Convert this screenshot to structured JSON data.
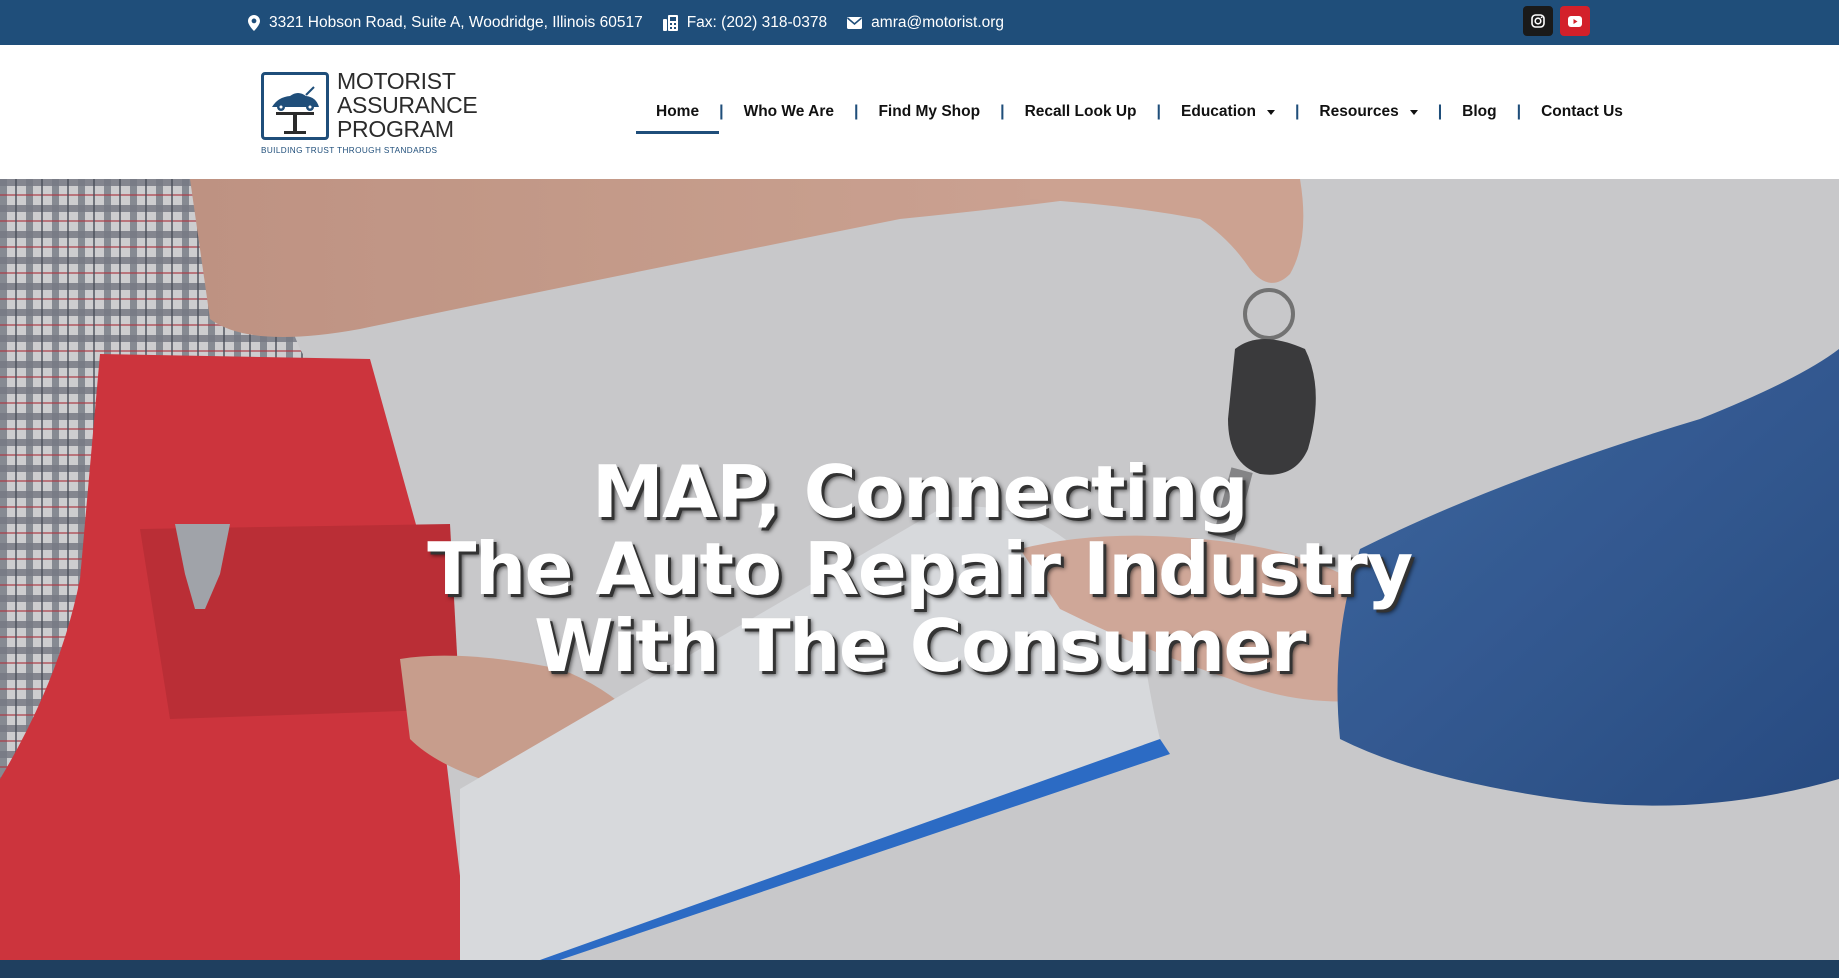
{
  "topbar": {
    "address": "3321 Hobson Road, Suite A, Woodridge, Illinois 60517",
    "fax": "Fax: (202) 318-0378",
    "email": "amra@motorist.org",
    "icons": [
      "map-pin-icon",
      "fax-icon",
      "envelope-icon"
    ],
    "socials": [
      "instagram-icon",
      "youtube-icon"
    ],
    "background_color": "#1f4e7a"
  },
  "logo": {
    "line1": "MOTORIST",
    "line2": "ASSURANCE",
    "line3": "PROGRAM",
    "tagline": "BUILDING TRUST THROUGH STANDARDS"
  },
  "nav": {
    "items": [
      {
        "label": "Home",
        "active": true
      },
      {
        "label": "Who We Are"
      },
      {
        "label": "Find My Shop"
      },
      {
        "label": "Recall Look Up"
      },
      {
        "label": "Education",
        "dropdown": true
      },
      {
        "label": "Resources",
        "dropdown": true
      },
      {
        "label": "Blog"
      },
      {
        "label": "Contact Us"
      }
    ],
    "separator": "|",
    "accent_color": "#1f4e7a"
  },
  "hero": {
    "line1": "MAP, Connecting",
    "line2": "The Auto Repair Industry",
    "line3": "With The Consumer"
  }
}
